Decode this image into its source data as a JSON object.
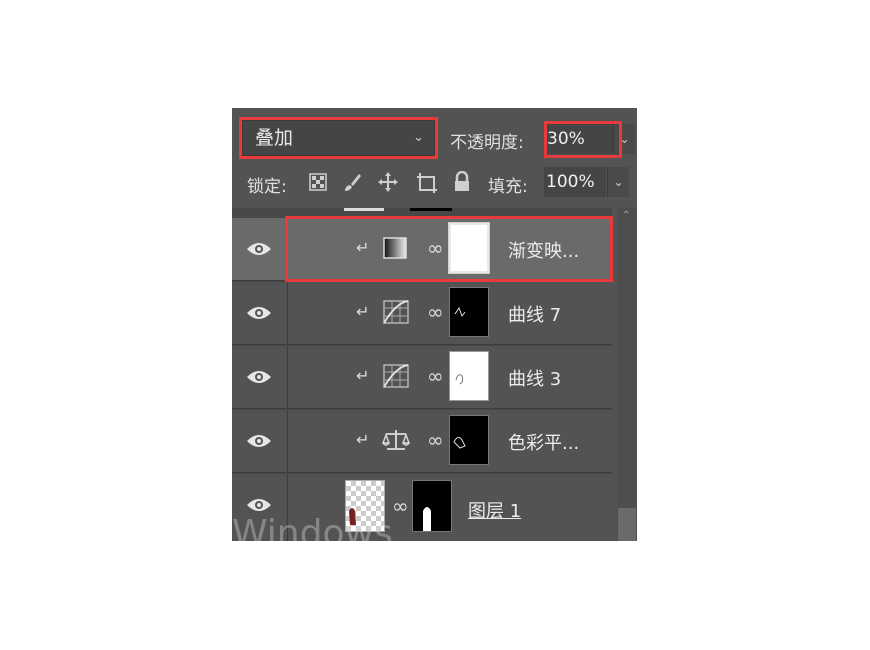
{
  "toolbar": {
    "blend_mode": "叠加",
    "opacity_label": "不透明度:",
    "opacity_value": "30%",
    "lock_label": "锁定:",
    "fill_label": "填充:",
    "fill_value": "100%"
  },
  "layers": [
    {
      "name": "渐变映...",
      "adjustment": "gradient-map-icon",
      "mask": "white",
      "selected": true
    },
    {
      "name": "曲线 7",
      "adjustment": "curves-icon",
      "mask": "black"
    },
    {
      "name": "曲线 3",
      "adjustment": "curves-icon",
      "mask": "white"
    },
    {
      "name": "色彩平...",
      "adjustment": "color-balance-icon",
      "mask": "black"
    },
    {
      "name": "图层 1",
      "adjustment": "",
      "mask": "black"
    }
  ],
  "watermark": "Windows",
  "colors": {
    "highlight": "#e83a3a",
    "panel": "#535353",
    "selected_row": "#6a6a6a"
  }
}
